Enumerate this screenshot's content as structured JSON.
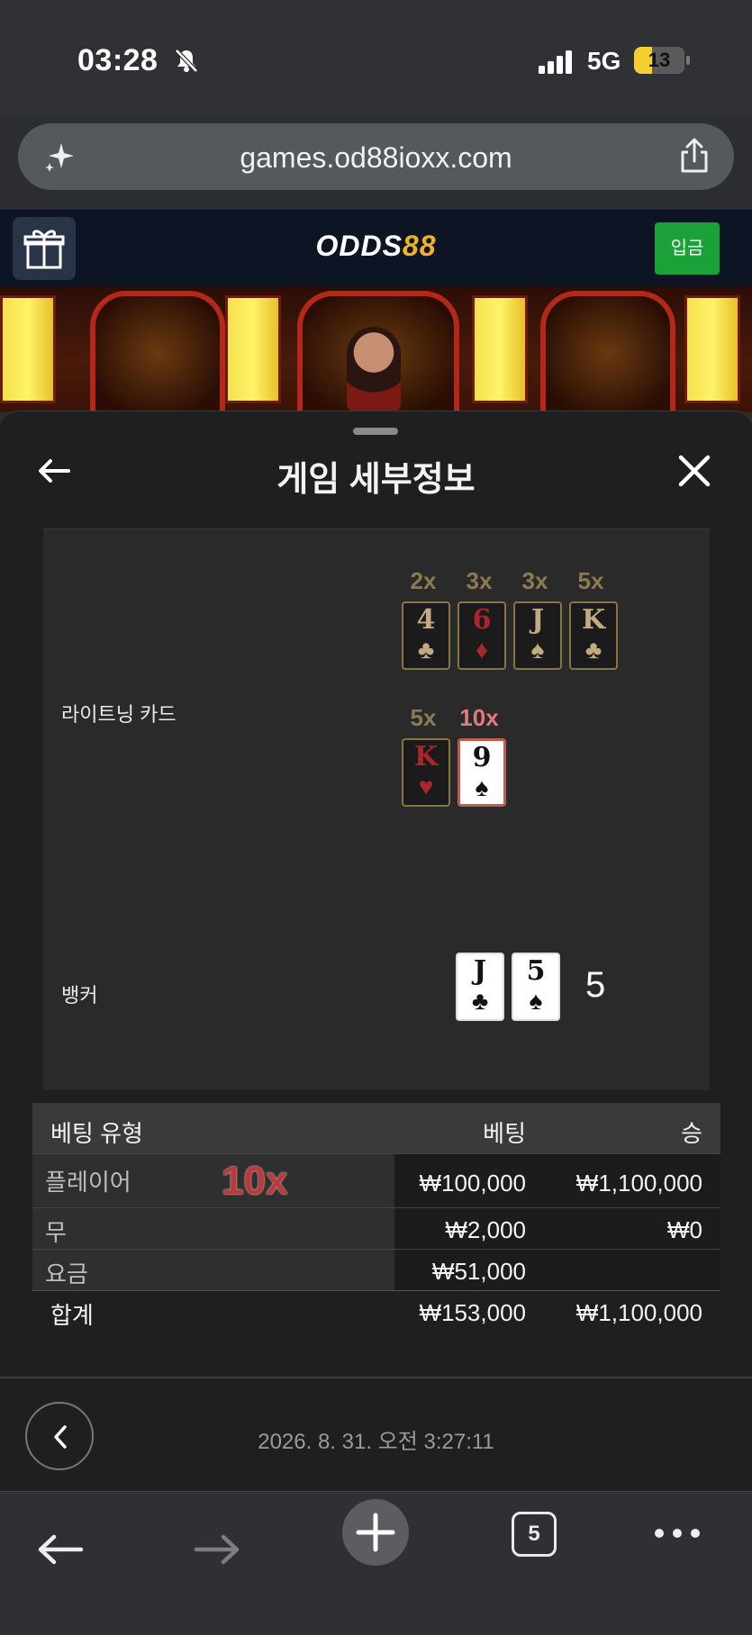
{
  "status": {
    "time": "03:28",
    "network": "5G",
    "battery": "13"
  },
  "browser": {
    "url": "games.od88ioxx.com",
    "tab_count": "5"
  },
  "site": {
    "logo_part1": "ODDS",
    "logo_part2": "88",
    "deposit_label": "입금"
  },
  "sheet": {
    "title": "게임 세부정보"
  },
  "lightning": {
    "label": "라이트닝 카드",
    "row1": [
      {
        "mult": "2x",
        "rank": "4",
        "suit": "♣",
        "color": "dark"
      },
      {
        "mult": "3x",
        "rank": "6",
        "suit": "♦",
        "color": "red"
      },
      {
        "mult": "3x",
        "rank": "J",
        "suit": "♠",
        "color": "dark"
      },
      {
        "mult": "5x",
        "rank": "K",
        "suit": "♣",
        "color": "dark"
      }
    ],
    "row2": [
      {
        "mult": "5x",
        "rank": "K",
        "suit": "♥",
        "color": "red"
      },
      {
        "mult": "10x",
        "rank": "9",
        "suit": "♠",
        "color": "highlight"
      }
    ]
  },
  "banker": {
    "label": "뱅커",
    "cards": [
      {
        "rank": "J",
        "suit": "♣"
      },
      {
        "rank": "5",
        "suit": "♠"
      }
    ],
    "score": "5"
  },
  "bets": {
    "headers": {
      "type": "베팅 유형",
      "bet": "베팅",
      "win": "승"
    },
    "rows": [
      {
        "type": "플레이어",
        "multiplier": "10x",
        "bet": "₩100,000",
        "win": "₩1,100,000"
      },
      {
        "type": "무",
        "bet": "₩2,000",
        "win": "₩0"
      },
      {
        "type": "요금",
        "bet": "₩51,000",
        "win": ""
      }
    ],
    "total": {
      "type": "합계",
      "bet": "₩153,000",
      "win": "₩1,100,000"
    }
  },
  "footer": {
    "timestamp": "2026. 8. 31. 오전 3:27:11"
  },
  "colors": {
    "deposit": "#1aa137",
    "logo_accent": "#f2b323",
    "multiplier_red": "#b83a3a"
  },
  "icons": [
    "bell-slash-icon",
    "signal-icon",
    "sparkle-icon",
    "share-icon",
    "gift-icon",
    "back-arrow-icon",
    "close-icon",
    "chevron-left-icon",
    "forward-arrow-icon",
    "plus-icon",
    "more-icon"
  ]
}
